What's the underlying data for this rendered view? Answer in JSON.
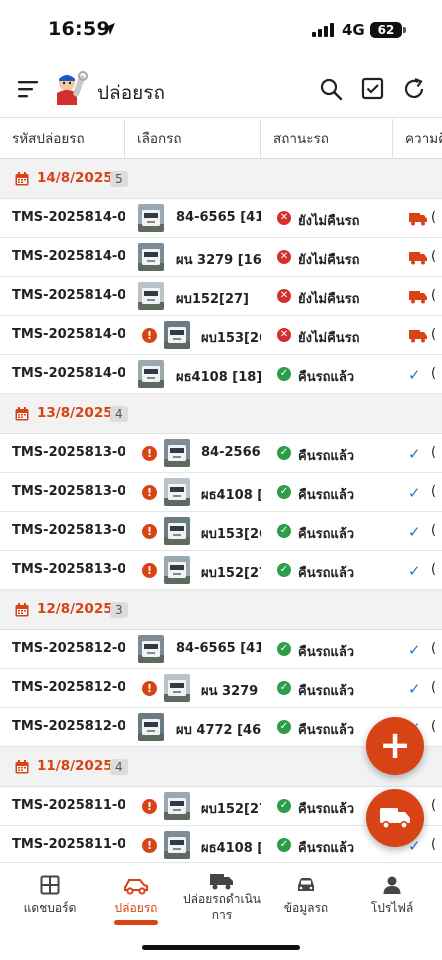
{
  "status_bar": {
    "time": "16:59",
    "network": "4G",
    "battery": "62"
  },
  "app_bar": {
    "title": "ปล่อยรถ"
  },
  "columns": [
    "รหัสปล่อยรถ",
    "เลือกรถ",
    "สถานะรถ",
    "ความคื"
  ],
  "groups": [
    {
      "date": "14/8/2025",
      "count": "5",
      "rows": [
        {
          "code": "TMS-2025814-0...",
          "warning": false,
          "plate": "84-6565 [41]",
          "status": "ยังไม่คืนรถ",
          "returned": false,
          "tail": "("
        },
        {
          "code": "TMS-2025814-0...",
          "warning": false,
          "plate": "ผน 3279 [16]",
          "status": "ยังไม่คืนรถ",
          "returned": false,
          "tail": "("
        },
        {
          "code": "TMS-2025814-0...",
          "warning": false,
          "plate": "ผบ152[27]",
          "status": "ยังไม่คืนรถ",
          "returned": false,
          "tail": "("
        },
        {
          "code": "TMS-2025814-0...",
          "warning": true,
          "plate": "ผบ153[26]",
          "status": "ยังไม่คืนรถ",
          "returned": false,
          "tail": "("
        },
        {
          "code": "TMS-2025814-0...",
          "warning": false,
          "plate": "ผธ4108 [18]",
          "status": "คืนรถแล้ว",
          "returned": true,
          "tail": "("
        }
      ]
    },
    {
      "date": "13/8/2025",
      "count": "4",
      "rows": [
        {
          "code": "TMS-2025813-0...",
          "warning": true,
          "plate": "84-2566[2",
          "status": "คืนรถแล้ว",
          "returned": true,
          "tail": "("
        },
        {
          "code": "TMS-2025813-0...",
          "warning": true,
          "plate": "ผธ4108 [1",
          "status": "คืนรถแล้ว",
          "returned": true,
          "tail": "("
        },
        {
          "code": "TMS-2025813-0...",
          "warning": true,
          "plate": "ผบ153[26]",
          "status": "คืนรถแล้ว",
          "returned": true,
          "tail": "("
        },
        {
          "code": "TMS-2025813-0...",
          "warning": true,
          "plate": "ผบ152[27]",
          "status": "คืนรถแล้ว",
          "returned": true,
          "tail": "("
        }
      ]
    },
    {
      "date": "12/8/2025",
      "count": "3",
      "rows": [
        {
          "code": "TMS-2025812-0...",
          "warning": false,
          "plate": "84-6565 [41]",
          "status": "คืนรถแล้ว",
          "returned": true,
          "tail": "("
        },
        {
          "code": "TMS-2025812-0...",
          "warning": true,
          "plate": "ผน 3279 [",
          "status": "คืนรถแล้ว",
          "returned": true,
          "tail": "("
        },
        {
          "code": "TMS-2025812-0...",
          "warning": false,
          "plate": "ผบ 4772 [46]",
          "status": "คืนรถแล้ว",
          "returned": true,
          "tail": "("
        }
      ]
    },
    {
      "date": "11/8/2025",
      "count": "4",
      "rows": [
        {
          "code": "TMS-2025811-0...",
          "warning": true,
          "plate": "ผบ152[27]",
          "status": "คืนรถแล้ว",
          "returned": true,
          "tail": "("
        },
        {
          "code": "TMS-2025811-0...",
          "warning": true,
          "plate": "ผธ4108 [1",
          "status": "คืนรถแล้ว",
          "returned": true,
          "tail": "("
        }
      ]
    }
  ],
  "bottom_nav": [
    {
      "label": "แดชบอร์ด",
      "icon": "dashboard-icon",
      "active": false
    },
    {
      "label": "ปล่อยรถ",
      "icon": "car-icon",
      "active": true
    },
    {
      "label": "ปล่อยรถดำเนินการ",
      "icon": "truck-icon",
      "active": false
    },
    {
      "label": "ข้อมูลรถ",
      "icon": "car-front-icon",
      "active": false
    },
    {
      "label": "โปรไฟล์",
      "icon": "person-icon",
      "active": false
    }
  ],
  "colors": {
    "accent": "#d84315",
    "ok": "#2e9d4a",
    "error": "#d32f2f",
    "check": "#1e7ae6"
  }
}
